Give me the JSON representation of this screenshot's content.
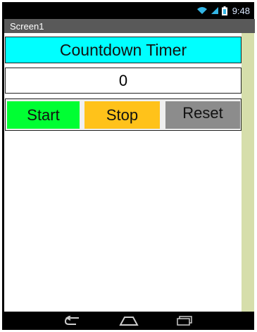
{
  "status_bar": {
    "time": "9:48",
    "icons": [
      "wifi-icon",
      "signal-icon",
      "battery-icon"
    ]
  },
  "screen": {
    "title": "Screen1"
  },
  "app": {
    "heading": "Countdown Timer",
    "timer_value": "0",
    "buttons": {
      "start": "Start",
      "stop": "Stop",
      "reset": "Reset"
    }
  },
  "nav_bar": {
    "icons": [
      "back-icon",
      "home-icon",
      "recent-apps-icon"
    ]
  },
  "colors": {
    "heading_bg": "#00ffff",
    "start_bg": "#00ff33",
    "stop_bg": "#ffc21a",
    "reset_bg": "#8c8c8c",
    "title_bar_bg": "#595959",
    "scroll_rail_bg": "#d6deab"
  }
}
